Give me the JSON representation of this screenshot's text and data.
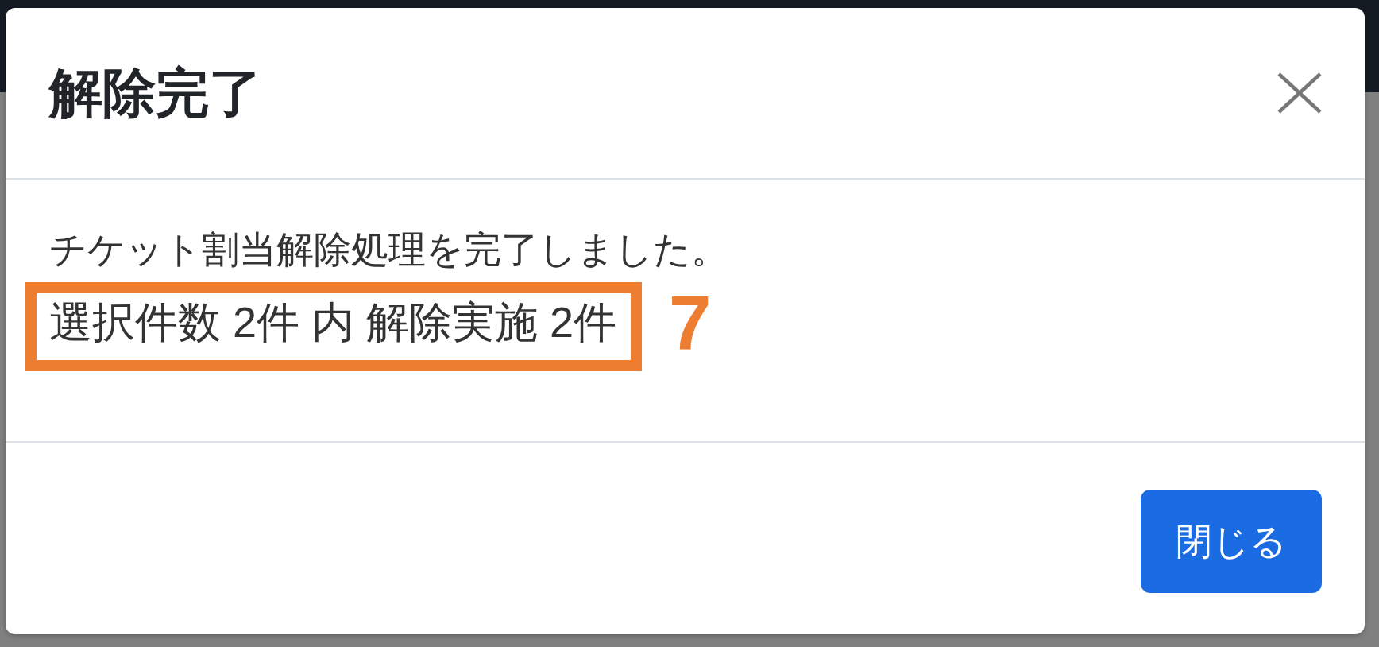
{
  "dialog": {
    "title": "解除完了",
    "message": "チケット割当解除処理を完了しました。",
    "summary": {
      "text": "選択件数 2件 内 解除実施 2件",
      "callout": "7"
    },
    "buttons": [
      {
        "label": "閉じる"
      }
    ]
  }
}
